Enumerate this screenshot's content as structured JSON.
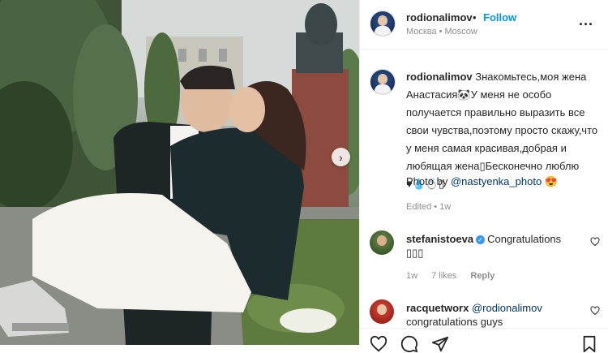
{
  "post": {
    "username": "rodionalimov",
    "dot": "•",
    "follow_label": "Follow",
    "location": "Москва • Moscow",
    "more_label": "..."
  },
  "caption": {
    "username": "rodionalimov",
    "text": "Знакомьтесь,моя жена Анастасия🐼У меня не особо получается правильно выразить все свои чувства,поэтому просто скажу,что у меня самая красивая,добрая и любящая жена▯Бесконечно люблю",
    "emojis": "♥💧💍▯",
    "photo_by_label": "Photo by",
    "photo_by_tag": "@nastyenka_photo",
    "photo_by_emoji": "😍",
    "meta": "Edited • 1w"
  },
  "comments": [
    {
      "username": "stefanistoeva",
      "verified": true,
      "text": "Congratulations ▯▯▯",
      "time": "1w",
      "likes": "7 likes",
      "reply_label": "Reply"
    },
    {
      "username": "racquetworx",
      "mention": "@rodionalimov",
      "text": "congratulations guys"
    }
  ],
  "colors": {
    "accent": "#0095f6",
    "muted": "#8e8e8e",
    "text": "#262626",
    "verified": "#3897f0"
  },
  "icons": [
    "more-icon",
    "heart-icon",
    "comment-icon",
    "share-icon",
    "bookmark-icon",
    "next-arrow-icon"
  ]
}
